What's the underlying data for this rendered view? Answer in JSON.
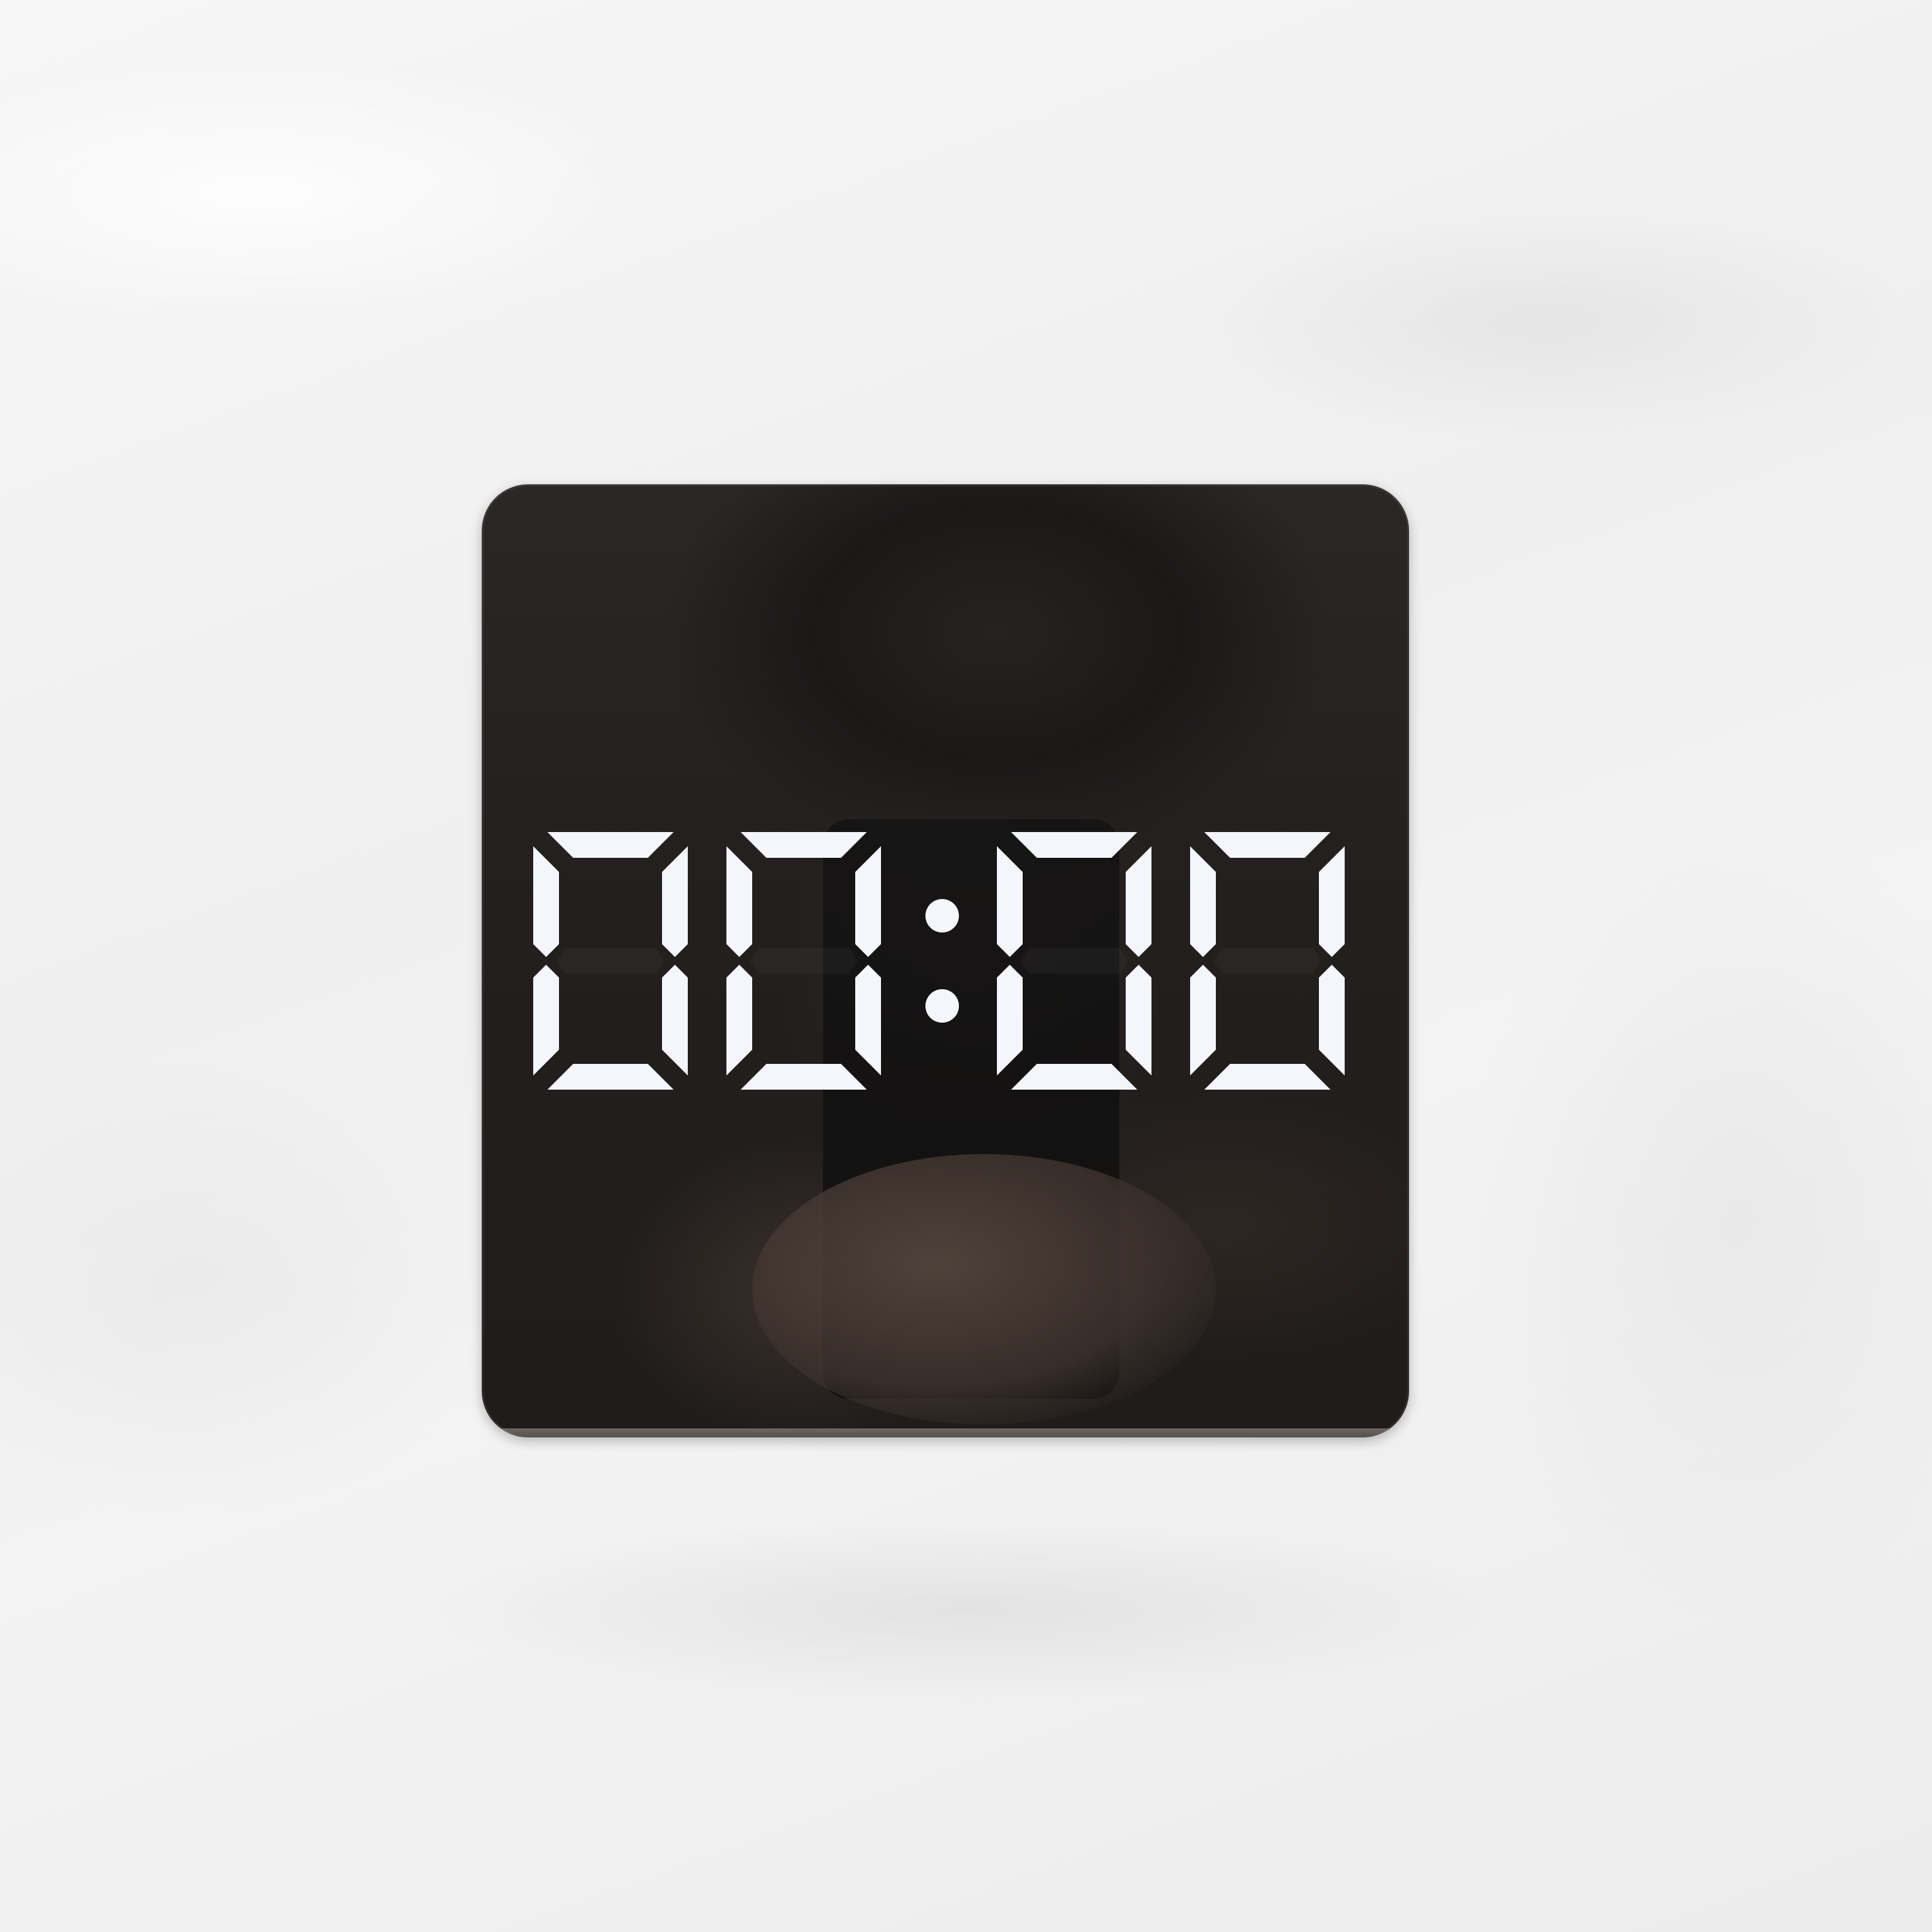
{
  "clock": {
    "time_display": "00:00",
    "digits": [
      "0",
      "0",
      "0",
      "0"
    ],
    "separator": ":",
    "led_color": "#f4f6fb"
  }
}
